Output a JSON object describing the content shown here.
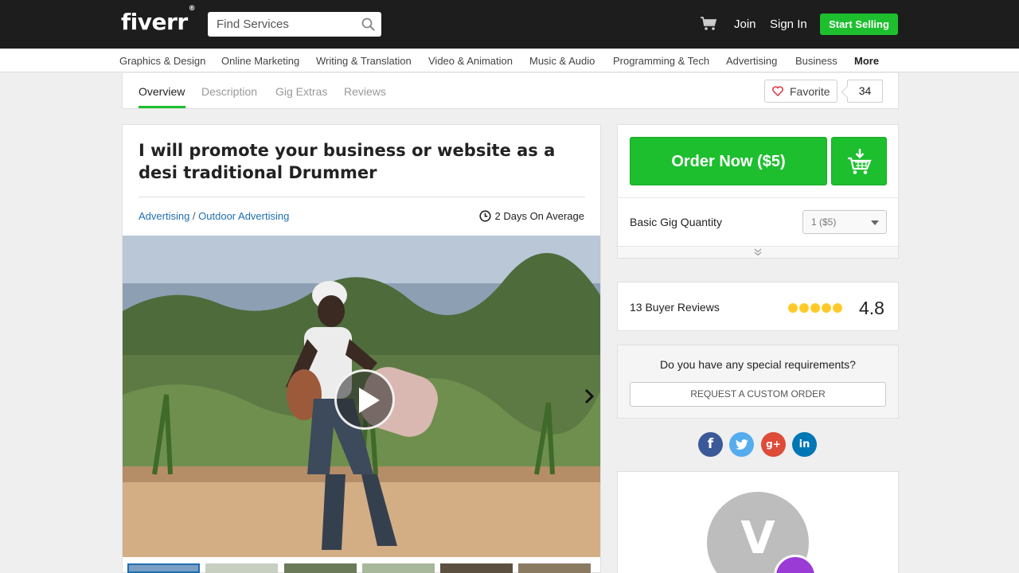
{
  "header": {
    "logo": "fiverr",
    "logo_mark": "®",
    "search_placeholder": "Find Services",
    "join": "Join",
    "sign_in": "Sign In",
    "start_selling": "Start Selling"
  },
  "categories": [
    "Graphics & Design",
    "Online Marketing",
    "Writing & Translation",
    "Video & Animation",
    "Music & Audio",
    "Programming & Tech",
    "Advertising",
    "Business",
    "More"
  ],
  "tabs": [
    "Overview",
    "Description",
    "Gig Extras",
    "Reviews"
  ],
  "favorite": {
    "label": "Favorite",
    "count": "34"
  },
  "gig": {
    "title": "I will promote your business or website as a desi traditional Drummer",
    "crumb_1": "Advertising",
    "crumb_sep": " / ",
    "crumb_2": "Outdoor Advertising",
    "delivery": "2 Days On Average"
  },
  "order": {
    "button": "Order Now ($5)",
    "quantity_label": "Basic Gig Quantity",
    "quantity_value": "1 ($5)"
  },
  "reviews": {
    "count_label": "13 Buyer Reviews",
    "rating": "4.8",
    "stars": 5
  },
  "custom": {
    "question": "Do you have any special requirements?",
    "button": "REQUEST A CUSTOM ORDER"
  },
  "social": {
    "facebook": "f",
    "twitter": "t",
    "googleplus": "g+",
    "linkedin": "in"
  },
  "seller": {
    "initial": "V"
  },
  "colors": {
    "brand_green": "#1dbf2e",
    "link_blue": "#1f6fb2",
    "star_yellow": "#ffca29",
    "header_bg": "#1d1d1d"
  }
}
